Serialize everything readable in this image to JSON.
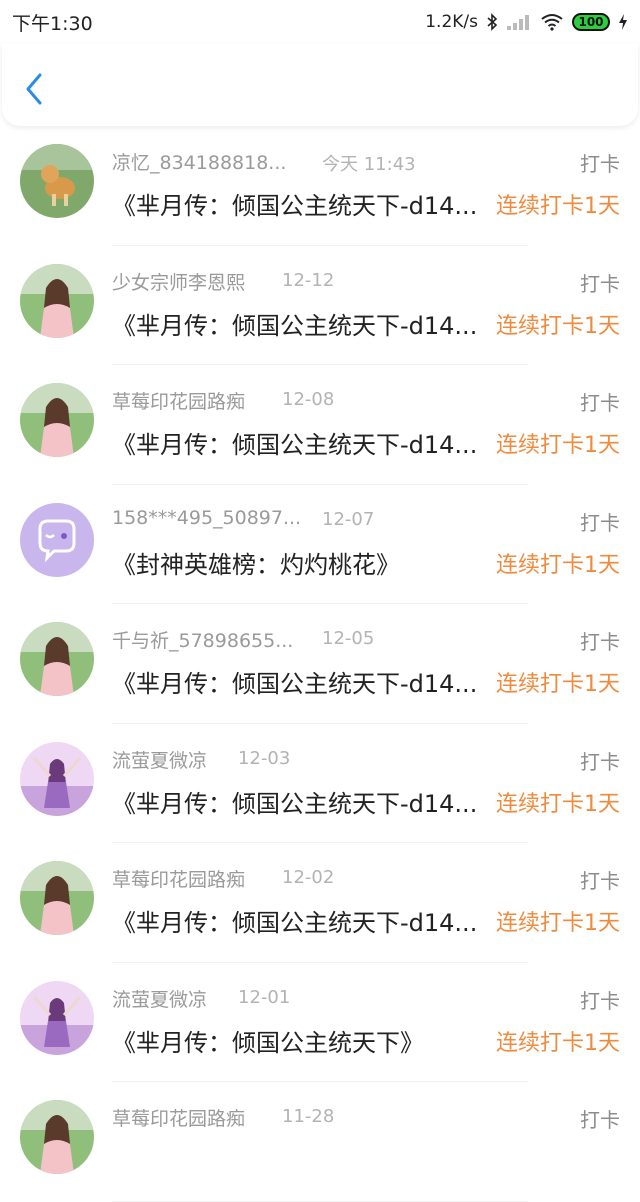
{
  "status": {
    "time": "下午1:30",
    "speed": "1.2K/s",
    "battery": "100"
  },
  "items": [
    {
      "name": "凉忆_834188818...",
      "date": "今天 11:43",
      "kind": "打卡",
      "title": "《芈月传：倾国公主统天下-d14...",
      "streak": "连续打卡1天",
      "avatar": "avatar-dog"
    },
    {
      "name": "少女宗师李恩熙",
      "date": "12-12",
      "kind": "打卡",
      "title": "《芈月传：倾国公主统天下-d14...",
      "streak": "连续打卡1天",
      "avatar": "avatar-girl"
    },
    {
      "name": "草莓印花园路痴",
      "date": "12-08",
      "kind": "打卡",
      "title": "《芈月传：倾国公主统天下-d14...",
      "streak": "连续打卡1天",
      "avatar": "avatar-girl"
    },
    {
      "name": "158***495_50897...",
      "date": "12-07",
      "kind": "打卡",
      "title": "《封神英雄榜：灼灼桃花》",
      "streak": "连续打卡1天",
      "avatar": "avatar-default"
    },
    {
      "name": "千与祈_57898655...",
      "date": "12-05",
      "kind": "打卡",
      "title": "《芈月传：倾国公主统天下-d14...",
      "streak": "连续打卡1天",
      "avatar": "avatar-girl"
    },
    {
      "name": "流萤夏微凉",
      "date": "12-03",
      "kind": "打卡",
      "title": "《芈月传：倾国公主统天下-d14...",
      "streak": "连续打卡1天",
      "avatar": "avatar-lavender"
    },
    {
      "name": "草莓印花园路痴",
      "date": "12-02",
      "kind": "打卡",
      "title": "《芈月传：倾国公主统天下-d14...",
      "streak": "连续打卡1天",
      "avatar": "avatar-girl"
    },
    {
      "name": "流萤夏微凉",
      "date": "12-01",
      "kind": "打卡",
      "title": "《芈月传：倾国公主统天下》",
      "streak": "连续打卡1天",
      "avatar": "avatar-lavender"
    },
    {
      "name": "草莓印花园路痴",
      "date": "11-28",
      "kind": "打卡",
      "title": "",
      "streak": "",
      "avatar": "avatar-girl"
    }
  ]
}
